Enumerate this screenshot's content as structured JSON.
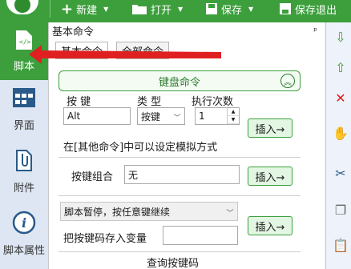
{
  "toolbar": {
    "new_label": "新建",
    "open_label": "打开",
    "save_label": "保存",
    "save_exit_label": "保存退出"
  },
  "sidebar": {
    "items": [
      {
        "label": "脚本",
        "icon": "script-file-icon",
        "active": true
      },
      {
        "label": "界面",
        "icon": "window-grid-icon",
        "active": false
      },
      {
        "label": "附件",
        "icon": "attachment-icon",
        "active": false
      },
      {
        "label": "脚本属性",
        "icon": "info-icon",
        "active": false
      }
    ]
  },
  "panel": {
    "title": "基本命令",
    "pin": "ᵖ",
    "tabs": [
      "基本命令",
      "全部命令"
    ],
    "section_title": "键盘命令",
    "key_label": "按 键",
    "type_label": "类 型",
    "count_label": "执行次数",
    "key_value": "Alt",
    "type_value": "按键",
    "count_value": "1",
    "insert_label": "插入→",
    "other_cmd_note": "在[其他命令]中可以设定模拟方式",
    "combo_label": "按键组合",
    "combo_value": "无",
    "pause_option": "脚本暂停，按任意键继续",
    "store_label": "把按键码存入变量",
    "store_value": "",
    "query_label": "查询按键码"
  },
  "colors": {
    "toolbar_green": "#3c9f3c",
    "sidebar_bg": "#dde6f2",
    "accent_green": "#2f7d2f",
    "annotation_red": "#e02020"
  }
}
